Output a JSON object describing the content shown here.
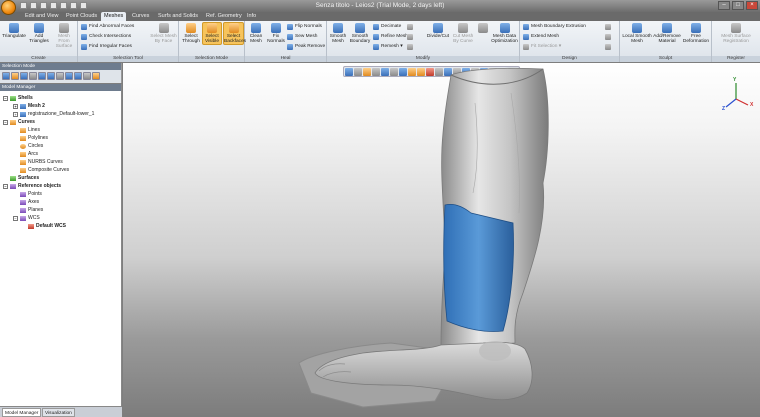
{
  "window": {
    "title": "Senza titolo - Leios2 (Trial Mode, 2 days left)"
  },
  "tabs": [
    "Edit and View",
    "Point Clouds",
    "Meshes",
    "Curves",
    "Surfs and Solids",
    "Ref. Geometry",
    "Info"
  ],
  "active_tab": "Meshes",
  "ribbon": {
    "create": {
      "label": "Create",
      "triangulate": "Triangulate",
      "add_triangles": "Add Triangles",
      "mesh_from_surface": "Mesh From Surface"
    },
    "selection_tool": {
      "label": "Selection Tool",
      "find_abnormal": "Find Abnormal Faces",
      "check_intersections": "Check Intersections",
      "find_irregular": "Find Irregular Faces",
      "select_mesh_by_face": "Select Mesh By Face"
    },
    "selection_mode": {
      "label": "Selection Mode",
      "select_through": "Select Through",
      "select_visible": "Select Visible",
      "select_backfaces": "Select Backfaces"
    },
    "heal": {
      "label": "Heal",
      "clean_mesh": "Clean Mesh",
      "fix_normals": "Fix Normals",
      "flip_normals": "Flip Normals",
      "sew_mesh": "Sew Mesh",
      "peak_remove": "Peak Remove"
    },
    "modify": {
      "label": "Modify",
      "smooth_mesh": "Smooth Mesh",
      "smooth_boundary": "Smooth Boundary",
      "decimate": "Decimate",
      "refine_mesh": "Refine Mesh",
      "remesh": "Remesh",
      "divide_cut": "Divide/Cut",
      "cut_mesh_by_curve": "Cut Mesh By Curve",
      "mesh_data_optimization": "Mesh Data Optimization"
    },
    "design": {
      "label": "Design",
      "mesh_boundary_extrusion": "Mesh Boundary Extrusion",
      "extend_mesh": "Extend Mesh",
      "fit_selection": "Fit Selection"
    },
    "sculpt": {
      "label": "Sculpt",
      "local_smooth_mesh": "Local Smooth Mesh",
      "add_remove_material": "Add/Remove Material",
      "free_deformation": "Free Deformation"
    },
    "register": {
      "label": "Register",
      "mesh_surface_registration": "Mesh Surface Registration"
    }
  },
  "selection_mode_panel": {
    "title": "Selection Mode"
  },
  "model_manager": {
    "title": "Model Manager",
    "tree": [
      {
        "label": "Shells",
        "bold": true
      },
      {
        "label": "Mesh 2",
        "bold": true
      },
      {
        "label": "registrazione_Default-lower_1",
        "bold": false
      },
      {
        "label": "Curves",
        "bold": true
      },
      {
        "label": "Lines",
        "bold": false
      },
      {
        "label": "Polylines",
        "bold": false
      },
      {
        "label": "Circles",
        "bold": false
      },
      {
        "label": "Arcs",
        "bold": false
      },
      {
        "label": "NURBS Curves",
        "bold": false
      },
      {
        "label": "Composite Curves",
        "bold": false
      },
      {
        "label": "Surfaces",
        "bold": true
      },
      {
        "label": "Reference objects",
        "bold": true
      },
      {
        "label": "Points",
        "bold": false
      },
      {
        "label": "Axes",
        "bold": false
      },
      {
        "label": "Planes",
        "bold": false
      },
      {
        "label": "WCS",
        "bold": false
      },
      {
        "label": "Default WCS",
        "bold": true
      }
    ]
  },
  "bottom_tabs": [
    "Model Manager",
    "Visualization"
  ],
  "viewport": {
    "axes": {
      "x": "X",
      "y": "Y",
      "z": "Z"
    },
    "mesh_color": "#c8c8c8",
    "selection_color": "#3d7fc4"
  }
}
